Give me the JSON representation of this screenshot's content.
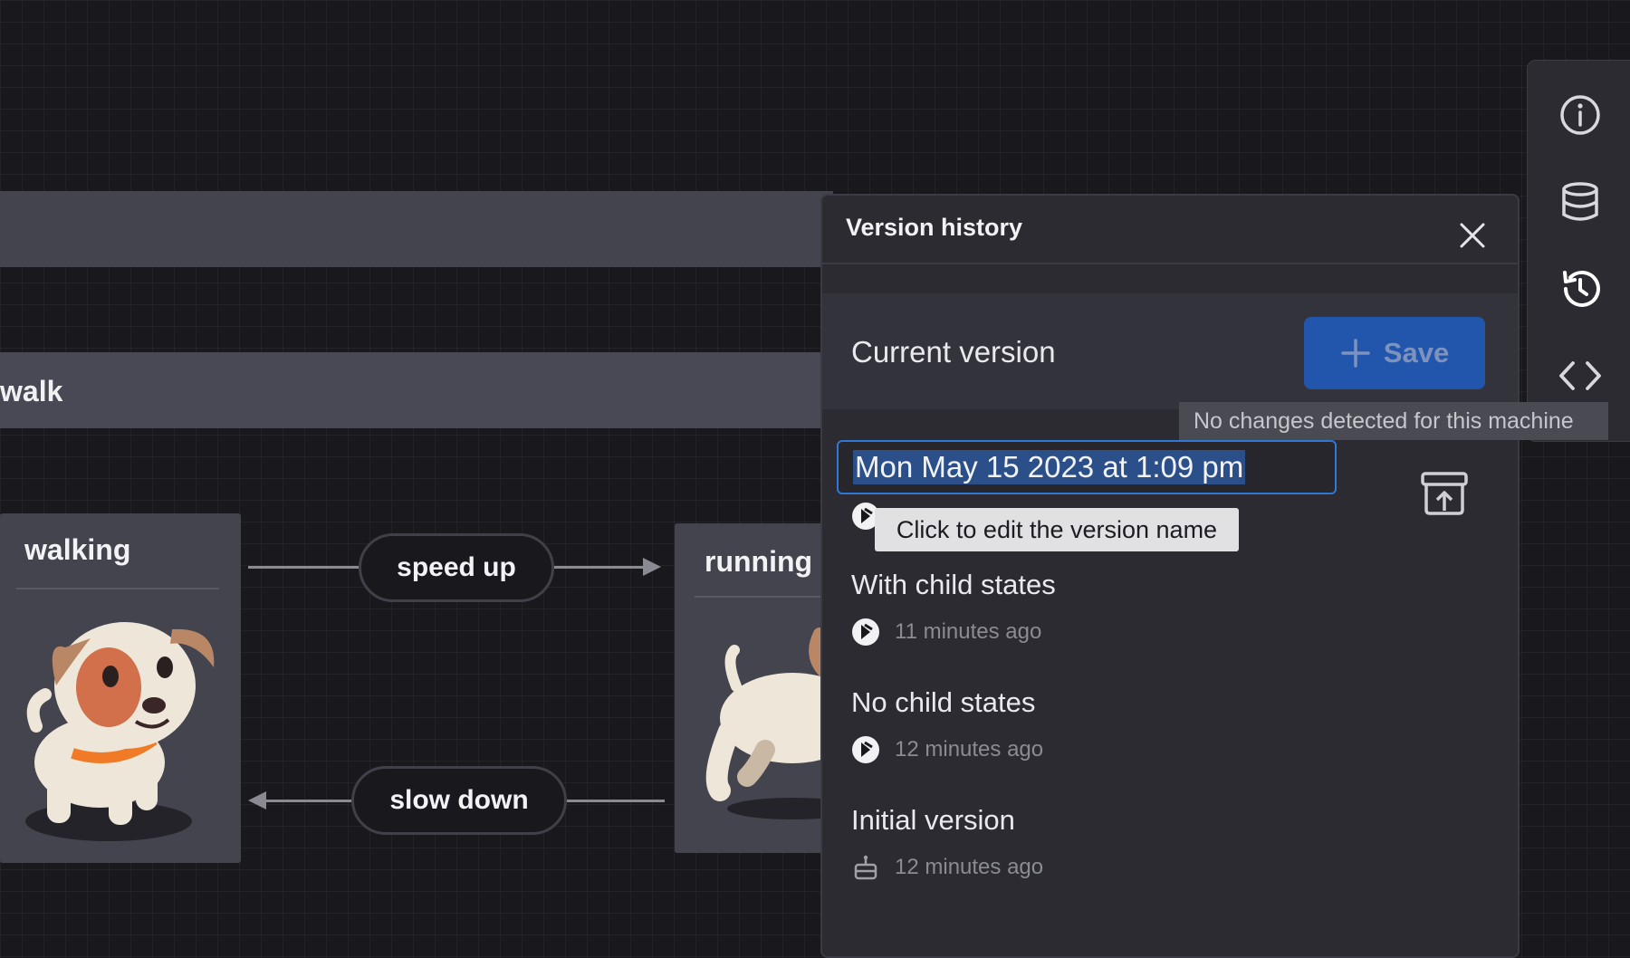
{
  "canvas": {
    "walk_label": "walk",
    "states": {
      "walking": "walking",
      "running": "running"
    },
    "events": {
      "speed_up": "speed up",
      "slow_down": "slow down"
    }
  },
  "rail": {
    "icons": [
      "info-icon",
      "database-icon",
      "history-icon",
      "code-icon"
    ]
  },
  "panel": {
    "title": "Version history",
    "current_version_label": "Current version",
    "save_label": "Save",
    "version_name_value": "Mon May 15 2023 at 1:09 pm",
    "versions": [
      {
        "title": "With child states",
        "time": "11 minutes ago",
        "icon": "studio-avatar-icon"
      },
      {
        "title": "No child states",
        "time": "12 minutes ago",
        "icon": "studio-avatar-icon"
      },
      {
        "title": "Initial version",
        "time": "12 minutes ago",
        "icon": "robot-icon"
      }
    ]
  },
  "tooltips": {
    "save_disabled": "No changes detected for this machine",
    "edit_name": "Click to edit the version name"
  },
  "colors": {
    "accent": "#2256ad",
    "focus": "#2f78d8",
    "background": "#19191d",
    "panel": "#2b2b31"
  }
}
